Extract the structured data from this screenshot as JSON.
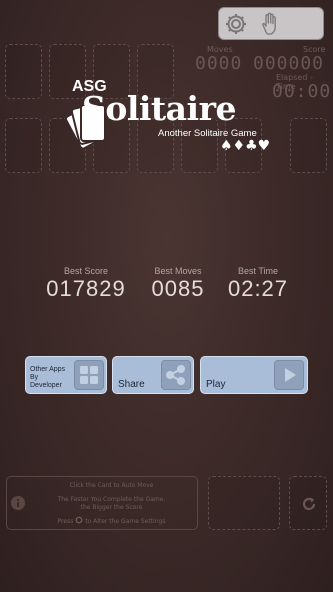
{
  "header": {
    "moves_label": "Moves",
    "moves_value": "0000",
    "score_label": "Score",
    "score_value": "000000",
    "elapsed_label": "Elapsed - Time",
    "elapsed_value": "00:00"
  },
  "logo": {
    "asg": "ASG",
    "title": "Solitaire",
    "subtitle": "Another Solitaire Game",
    "suits": "♠♦♣♥"
  },
  "stats": {
    "best_score_label": "Best Score",
    "best_score_value": "017829",
    "best_moves_label": "Best Moves",
    "best_moves_value": "0085",
    "best_time_label": "Best Time",
    "best_time_value": "02:27"
  },
  "buttons": {
    "other_apps_label": "Other Apps By Developer",
    "share_label": "Share",
    "play_label": "Play"
  },
  "hint": {
    "line1": "Click the Card to Auto Move",
    "line2": "The Faster You Complete the Game,",
    "line3": "the Bigger the Score",
    "line4_pre": "Press",
    "line4_post": "to Alter the Game Settings"
  },
  "icons": {
    "settings": "gear-icon",
    "hand": "hand-icon",
    "apps": "grid-icon",
    "share": "share-icon",
    "play": "play-icon",
    "info": "info-icon",
    "restart": "restart-icon"
  },
  "colors": {
    "background": "#3b2927",
    "button": "#a9bdd9",
    "toolbar": "#c9c4c5"
  }
}
